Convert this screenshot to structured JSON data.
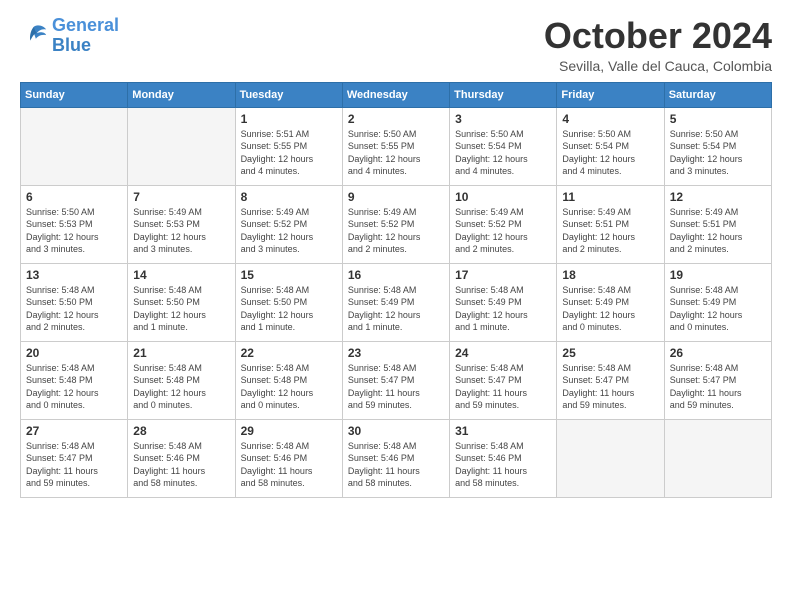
{
  "logo": {
    "line1": "General",
    "line2": "Blue"
  },
  "title": "October 2024",
  "subtitle": "Sevilla, Valle del Cauca, Colombia",
  "days_of_week": [
    "Sunday",
    "Monday",
    "Tuesday",
    "Wednesday",
    "Thursday",
    "Friday",
    "Saturday"
  ],
  "weeks": [
    [
      {
        "day": "",
        "info": ""
      },
      {
        "day": "",
        "info": ""
      },
      {
        "day": "1",
        "info": "Sunrise: 5:51 AM\nSunset: 5:55 PM\nDaylight: 12 hours\nand 4 minutes."
      },
      {
        "day": "2",
        "info": "Sunrise: 5:50 AM\nSunset: 5:55 PM\nDaylight: 12 hours\nand 4 minutes."
      },
      {
        "day": "3",
        "info": "Sunrise: 5:50 AM\nSunset: 5:54 PM\nDaylight: 12 hours\nand 4 minutes."
      },
      {
        "day": "4",
        "info": "Sunrise: 5:50 AM\nSunset: 5:54 PM\nDaylight: 12 hours\nand 4 minutes."
      },
      {
        "day": "5",
        "info": "Sunrise: 5:50 AM\nSunset: 5:54 PM\nDaylight: 12 hours\nand 3 minutes."
      }
    ],
    [
      {
        "day": "6",
        "info": "Sunrise: 5:50 AM\nSunset: 5:53 PM\nDaylight: 12 hours\nand 3 minutes."
      },
      {
        "day": "7",
        "info": "Sunrise: 5:49 AM\nSunset: 5:53 PM\nDaylight: 12 hours\nand 3 minutes."
      },
      {
        "day": "8",
        "info": "Sunrise: 5:49 AM\nSunset: 5:52 PM\nDaylight: 12 hours\nand 3 minutes."
      },
      {
        "day": "9",
        "info": "Sunrise: 5:49 AM\nSunset: 5:52 PM\nDaylight: 12 hours\nand 2 minutes."
      },
      {
        "day": "10",
        "info": "Sunrise: 5:49 AM\nSunset: 5:52 PM\nDaylight: 12 hours\nand 2 minutes."
      },
      {
        "day": "11",
        "info": "Sunrise: 5:49 AM\nSunset: 5:51 PM\nDaylight: 12 hours\nand 2 minutes."
      },
      {
        "day": "12",
        "info": "Sunrise: 5:49 AM\nSunset: 5:51 PM\nDaylight: 12 hours\nand 2 minutes."
      }
    ],
    [
      {
        "day": "13",
        "info": "Sunrise: 5:48 AM\nSunset: 5:50 PM\nDaylight: 12 hours\nand 2 minutes."
      },
      {
        "day": "14",
        "info": "Sunrise: 5:48 AM\nSunset: 5:50 PM\nDaylight: 12 hours\nand 1 minute."
      },
      {
        "day": "15",
        "info": "Sunrise: 5:48 AM\nSunset: 5:50 PM\nDaylight: 12 hours\nand 1 minute."
      },
      {
        "day": "16",
        "info": "Sunrise: 5:48 AM\nSunset: 5:49 PM\nDaylight: 12 hours\nand 1 minute."
      },
      {
        "day": "17",
        "info": "Sunrise: 5:48 AM\nSunset: 5:49 PM\nDaylight: 12 hours\nand 1 minute."
      },
      {
        "day": "18",
        "info": "Sunrise: 5:48 AM\nSunset: 5:49 PM\nDaylight: 12 hours\nand 0 minutes."
      },
      {
        "day": "19",
        "info": "Sunrise: 5:48 AM\nSunset: 5:49 PM\nDaylight: 12 hours\nand 0 minutes."
      }
    ],
    [
      {
        "day": "20",
        "info": "Sunrise: 5:48 AM\nSunset: 5:48 PM\nDaylight: 12 hours\nand 0 minutes."
      },
      {
        "day": "21",
        "info": "Sunrise: 5:48 AM\nSunset: 5:48 PM\nDaylight: 12 hours\nand 0 minutes."
      },
      {
        "day": "22",
        "info": "Sunrise: 5:48 AM\nSunset: 5:48 PM\nDaylight: 12 hours\nand 0 minutes."
      },
      {
        "day": "23",
        "info": "Sunrise: 5:48 AM\nSunset: 5:47 PM\nDaylight: 11 hours\nand 59 minutes."
      },
      {
        "day": "24",
        "info": "Sunrise: 5:48 AM\nSunset: 5:47 PM\nDaylight: 11 hours\nand 59 minutes."
      },
      {
        "day": "25",
        "info": "Sunrise: 5:48 AM\nSunset: 5:47 PM\nDaylight: 11 hours\nand 59 minutes."
      },
      {
        "day": "26",
        "info": "Sunrise: 5:48 AM\nSunset: 5:47 PM\nDaylight: 11 hours\nand 59 minutes."
      }
    ],
    [
      {
        "day": "27",
        "info": "Sunrise: 5:48 AM\nSunset: 5:47 PM\nDaylight: 11 hours\nand 59 minutes."
      },
      {
        "day": "28",
        "info": "Sunrise: 5:48 AM\nSunset: 5:46 PM\nDaylight: 11 hours\nand 58 minutes."
      },
      {
        "day": "29",
        "info": "Sunrise: 5:48 AM\nSunset: 5:46 PM\nDaylight: 11 hours\nand 58 minutes."
      },
      {
        "day": "30",
        "info": "Sunrise: 5:48 AM\nSunset: 5:46 PM\nDaylight: 11 hours\nand 58 minutes."
      },
      {
        "day": "31",
        "info": "Sunrise: 5:48 AM\nSunset: 5:46 PM\nDaylight: 11 hours\nand 58 minutes."
      },
      {
        "day": "",
        "info": ""
      },
      {
        "day": "",
        "info": ""
      }
    ]
  ]
}
